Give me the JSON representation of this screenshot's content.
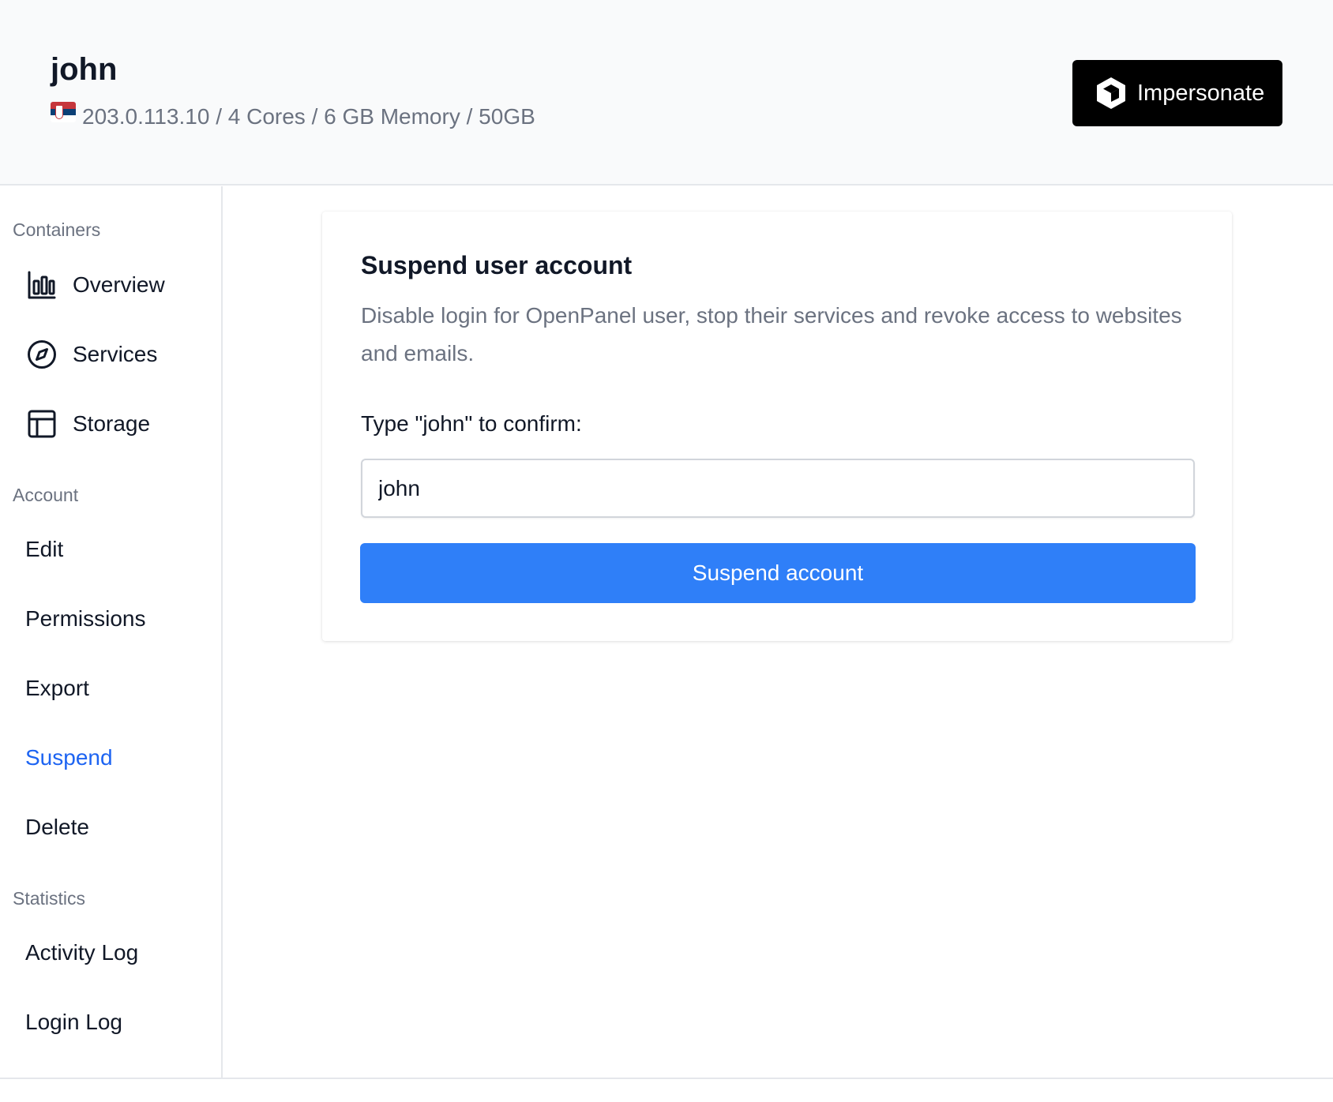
{
  "header": {
    "username": "john",
    "flag_icon": "serbia-flag-icon",
    "server_info": "203.0.113.10 / 4 Cores / 6 GB Memory / 50GB",
    "impersonate_label": "Impersonate"
  },
  "sidebar": {
    "sections": [
      {
        "title": "Containers",
        "items": [
          {
            "label": "Overview",
            "icon": "bar-chart-icon"
          },
          {
            "label": "Services",
            "icon": "compass-icon"
          },
          {
            "label": "Storage",
            "icon": "table-icon"
          }
        ]
      },
      {
        "title": "Account",
        "items": [
          {
            "label": "Edit"
          },
          {
            "label": "Permissions"
          },
          {
            "label": "Export"
          },
          {
            "label": "Suspend",
            "active": true
          },
          {
            "label": "Delete"
          }
        ]
      },
      {
        "title": "Statistics",
        "items": [
          {
            "label": "Activity Log"
          },
          {
            "label": "Login Log"
          }
        ]
      }
    ]
  },
  "main": {
    "card": {
      "title": "Suspend user account",
      "description": "Disable login for OpenPanel user, stop their services and revoke access to websites and emails.",
      "confirm_label": "Type \"john\" to confirm:",
      "confirm_value": "john",
      "button_label": "Suspend account"
    }
  },
  "colors": {
    "accent": "#2f7ff8",
    "active_link": "#1d64f2",
    "header_bg": "#f9fafb",
    "impersonate_bg": "#000000"
  }
}
